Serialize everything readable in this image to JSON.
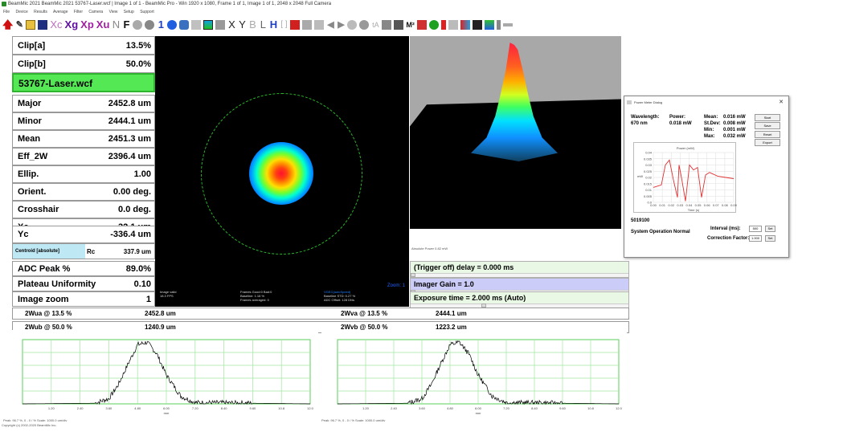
{
  "titlebar": {
    "text": "BeamMic 2021 BeamMic 2021 53767-Laser.wcf | Image 1 of 1 - BeamMic Pro - Win 1920 x 1080, Frame 1 of 1, Image 1 of 1, 2048 x 2048 Full Camera"
  },
  "menubar": {
    "items": [
      "File",
      "Device",
      "Results",
      "Average",
      "Filter",
      "Camera",
      "View",
      "Setup",
      "Support"
    ]
  },
  "toolbar": {
    "xc": "Xc",
    "xg": "Xg",
    "xp": "Xp",
    "xu": "Xu",
    "n": "N",
    "f": "F",
    "one": "1",
    "x": "X",
    "y": "Y",
    "b": "B",
    "l": "L",
    "h": "H",
    "bracket": "[ ]",
    "ta": "tA",
    "m2": "M²"
  },
  "left": {
    "clip_a": {
      "label": "Clip[a]",
      "value": "13.5%"
    },
    "clip_b": {
      "label": "Clip[b]",
      "value": "50.0%"
    },
    "filename": "53767-Laser.wcf",
    "major": {
      "label": "Major",
      "value": "2452.8 um"
    },
    "minor": {
      "label": "Minor",
      "value": "2444.1 um"
    },
    "mean": {
      "label": "Mean",
      "value": "2451.3 um"
    },
    "eff": {
      "label": "Eff_2W",
      "value": "2396.4 um"
    },
    "ellip": {
      "label": "Ellip.",
      "value": "1.00"
    },
    "orient": {
      "label": "Orient.",
      "value": "0.00 deg."
    },
    "crosshair": {
      "label": "Crosshair",
      "value": "0.0 deg."
    },
    "xc": {
      "label": "Xc",
      "value": "32.1 um"
    },
    "yc": {
      "label": "Yc",
      "value": "-336.4 um"
    },
    "centroid": {
      "label": "Centroid [absolute]",
      "rc_label": "Rc",
      "rc_value": "337.9 um"
    },
    "adc": {
      "label": "ADC Peak %",
      "value": "89.0%"
    },
    "plateau": {
      "label": "Plateau Uniformity",
      "value": "0.10"
    },
    "zoom": {
      "label": "Image zoom",
      "value": "1"
    }
  },
  "beam": {
    "info1": "Image valid",
    "info1b": "18.3 FPS",
    "info2": "Frames Good:0 Bad:0",
    "info2b": "Baseline: 1.16 %",
    "info2c": "Frames averaged: 0",
    "info3": "VGEC(autoSpeed)",
    "info3b": "Baseline STD: 0.27 %",
    "info3c": "ADC Offset: 128 DNs",
    "zoom": "Zoom: 1"
  },
  "v3d": {
    "footer": "Absolute Power 0.82 mW"
  },
  "controls": {
    "trigger": "(Trigger off) delay = 0.000 ms",
    "gain": "Imager Gain = 1.0",
    "exposure": "Exposure time = 2.000 ms (Auto)"
  },
  "widths": {
    "wua_label": "2Wua @ 13.5 %",
    "wua_value": "2452.8 um",
    "wva_label": "2Wva @ 13.5 %",
    "wva_value": "2444.1 um",
    "wub_label": "2Wub @ 50.0 %",
    "wub_value": "1240.9 um",
    "wvb_label": "2Wvb @ 50.0 %",
    "wvb_value": "1223.2 um"
  },
  "profiles": {
    "xticks": [
      "",
      "1.20",
      "2.40",
      "3.60",
      "4.80",
      "6.00",
      "7.20",
      "8.40",
      "9.60",
      "10.8",
      "12.0"
    ],
    "xunit": "mm",
    "foot_left": "Peak: 96.7 %, 0 - 0 / % Scale: 1000.0 um/div",
    "foot_right": "Peak: 96.7 %, 0 - 0 / % Scale: 1000.0 um/div",
    "copyright": "Copyright (c) 2002-2020 BeamMic Inc."
  },
  "dialog": {
    "title": "Power Meter Dialog",
    "close": "✕",
    "wavelength_label": "Wavelength:",
    "wavelength_value": "670 nm",
    "power_label": "Power:",
    "power_value": "0.018 mW",
    "mean_label": "Mean:",
    "mean_value": "0.016 mW",
    "stdev_label": "St.Dev:",
    "stdev_value": "0.008 mW",
    "min_label": "Min:",
    "min_value": "0.001 mW",
    "max_label": "Max:",
    "max_value": "0.032 mW",
    "btn_start": "Start",
    "btn_save": "Save",
    "btn_reset": "Reset",
    "btn_export": "Export",
    "chart_title": "Power (mW)",
    "chart_xunit": "Time (s)",
    "chart_yunit": "mW",
    "serial": "5019100",
    "status": "System Operation Normal",
    "interval_label": "Interval (ms):",
    "interval_value": "500",
    "correction_label": "Correction Factor:",
    "correction_value": "1.000",
    "set1": "Set",
    "set2": "Set"
  },
  "chart_data": [
    {
      "type": "line",
      "title": "Power (mW)",
      "xlabel": "Time (s)",
      "ylabel": "mW",
      "ylim": [
        0,
        0.04
      ],
      "yticks": [
        "0.04",
        "0.035",
        "0.03",
        "0.025",
        "0.02",
        "0.015",
        "0.01",
        "0.005",
        "0.0"
      ],
      "xticks": [
        "0.00",
        "0.01",
        "0.02",
        "0.03",
        "0.04",
        "0.05",
        "0.06",
        "0.07",
        "0.08",
        "0.09"
      ],
      "series": [
        {
          "x": [
            0,
            0.01,
            0.015,
            0.02,
            0.025,
            0.03,
            0.032,
            0.035,
            0.04,
            0.045,
            0.05,
            0.055,
            0.06,
            0.065,
            0.07,
            0.08,
            0.09,
            0.1
          ],
          "values": [
            0.012,
            0.014,
            0.03,
            0.034,
            0.018,
            0.004,
            0.03,
            0.02,
            0.001,
            0.03,
            0.026,
            0.028,
            0.004,
            0.022,
            0.024,
            0.021,
            0.02,
            0.019
          ]
        }
      ]
    },
    {
      "type": "line",
      "xlabel": "mm",
      "xlim": [
        0,
        12
      ],
      "ylim": [
        0,
        100
      ],
      "series": [
        {
          "x": [
            0,
            3.0,
            3.6,
            4.0,
            4.4,
            4.8,
            5.2,
            5.6,
            6.0,
            6.6,
            7.2,
            12
          ],
          "values": [
            0,
            1,
            8,
            30,
            62,
            92,
            96,
            78,
            45,
            12,
            2,
            0
          ]
        }
      ]
    },
    {
      "type": "line",
      "xlabel": "mm",
      "xlim": [
        0,
        12
      ],
      "ylim": [
        0,
        100
      ],
      "series": [
        {
          "x": [
            0,
            3.0,
            3.6,
            4.0,
            4.4,
            4.8,
            5.2,
            5.6,
            6.0,
            6.6,
            7.2,
            12
          ],
          "values": [
            0,
            1,
            8,
            30,
            62,
            92,
            96,
            78,
            45,
            12,
            2,
            0
          ]
        }
      ]
    }
  ]
}
